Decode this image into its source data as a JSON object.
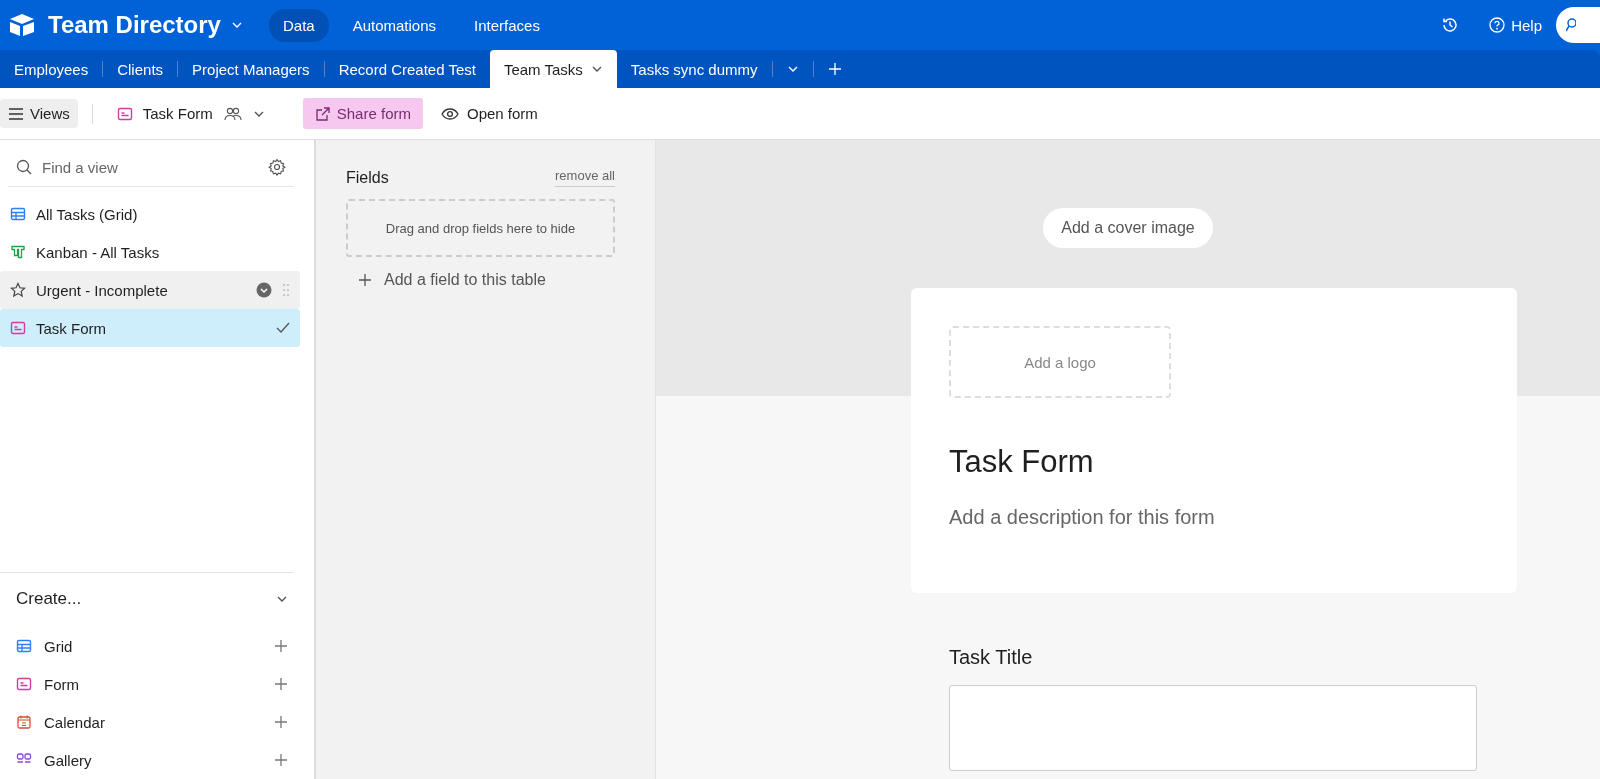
{
  "app": {
    "base_name": "Team Directory",
    "nav": [
      {
        "label": "Data",
        "selected": true
      },
      {
        "label": "Automations",
        "selected": false
      },
      {
        "label": "Interfaces",
        "selected": false
      }
    ],
    "help": "Help"
  },
  "tables": [
    {
      "label": "Employees",
      "selected": false
    },
    {
      "label": "Clients",
      "selected": false
    },
    {
      "label": "Project Managers",
      "selected": false
    },
    {
      "label": "Record Created Test",
      "selected": false
    },
    {
      "label": "Team Tasks",
      "selected": true
    },
    {
      "label": "Tasks sync dummy",
      "selected": false
    }
  ],
  "toolbar": {
    "views_button": "Views",
    "view_name": "Task Form",
    "share": "Share form",
    "open": "Open form"
  },
  "sidebar": {
    "search": {
      "placeholder": "Find a view"
    },
    "views": [
      {
        "label": "All Tasks (Grid)",
        "kind": "grid",
        "selected": false,
        "hovered": false
      },
      {
        "label": "Kanban - All Tasks",
        "kind": "kanban",
        "selected": false,
        "hovered": false
      },
      {
        "label": "Urgent - Incomplete",
        "kind": "star",
        "selected": false,
        "hovered": true
      },
      {
        "label": "Task Form",
        "kind": "form",
        "selected": true,
        "hovered": false
      }
    ],
    "create_title": "Create...",
    "create_items": [
      {
        "label": "Grid",
        "kind": "grid"
      },
      {
        "label": "Form",
        "kind": "form"
      },
      {
        "label": "Calendar",
        "kind": "calendar"
      },
      {
        "label": "Gallery",
        "kind": "gallery"
      }
    ]
  },
  "fields_panel": {
    "title": "Fields",
    "remove_all": "remove all",
    "drop_hint": "Drag and drop fields here to hide",
    "add_field": "Add a field to this table"
  },
  "form": {
    "cover_button": "Add a cover image",
    "logo_button": "Add a logo",
    "title": "Task Form",
    "description": "Add a description for this form",
    "fields": [
      {
        "label": "Task Title"
      }
    ]
  }
}
